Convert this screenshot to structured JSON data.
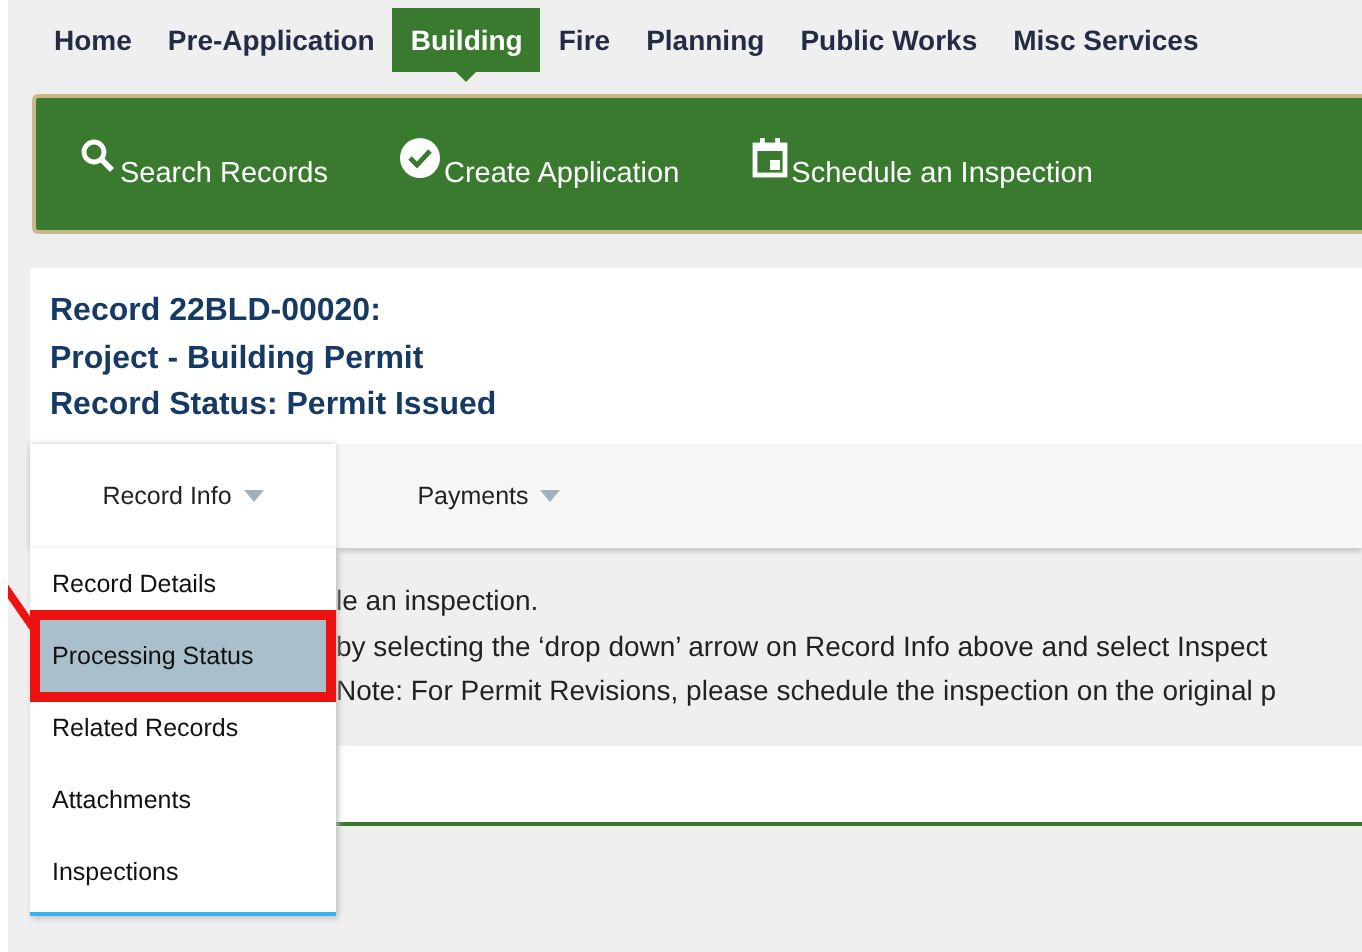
{
  "nav_tabs": [
    {
      "label": "Home",
      "selected": false
    },
    {
      "label": "Pre-Application",
      "selected": false
    },
    {
      "label": "Building",
      "selected": true
    },
    {
      "label": "Fire",
      "selected": false
    },
    {
      "label": "Planning",
      "selected": false
    },
    {
      "label": "Public Works",
      "selected": false
    },
    {
      "label": "Misc Services",
      "selected": false
    }
  ],
  "action_bar": [
    {
      "kind": "search",
      "label": "Search Records"
    },
    {
      "kind": "check",
      "label": "Create Application"
    },
    {
      "kind": "calendar",
      "label": "Schedule an Inspection"
    }
  ],
  "record": {
    "lines": [
      "Record 22BLD-00020:",
      "Project - Building Permit",
      "Record Status: Permit Issued"
    ]
  },
  "record_tabs": [
    {
      "label": "Record Info",
      "selected": true
    },
    {
      "label": "Payments",
      "selected": false
    }
  ],
  "dropdown": [
    {
      "label": "Record Details",
      "selected": false
    },
    {
      "label": "Processing Status",
      "selected": true
    },
    {
      "label": "Related Records",
      "selected": false
    },
    {
      "label": "Attachments",
      "selected": false
    },
    {
      "label": "Inspections",
      "selected": false
    }
  ],
  "notice_lines": [
    "le an inspection.",
    "by selecting the ‘drop down’ arrow on Record Info above and select Inspect",
    "Note: For Permit Revisions, please schedule the inspection on the original p"
  ]
}
